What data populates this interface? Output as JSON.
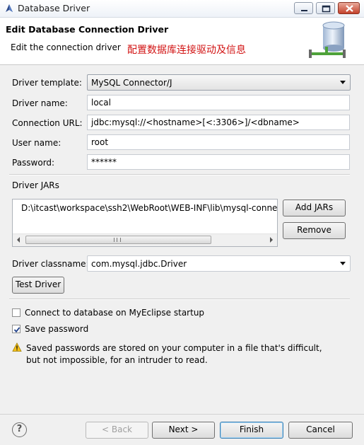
{
  "window": {
    "title": "Database Driver",
    "controls": {
      "minimize": "minimize-icon",
      "maximize": "maximize-icon",
      "close": "close-icon"
    }
  },
  "header": {
    "title": "Edit Database Connection Driver",
    "description": "Edit the connection driver",
    "note": "配置数据库连接驱动及信息"
  },
  "form": {
    "driver_template": {
      "label": "Driver template:",
      "value": "MySQL Connector/J"
    },
    "driver_name": {
      "label": "Driver name:",
      "value": "local"
    },
    "connection_url": {
      "label": "Connection URL:",
      "value": "jdbc:mysql://<hostname>[<:3306>]/<dbname>"
    },
    "user_name": {
      "label": "User name:",
      "value": "root"
    },
    "password": {
      "label": "Password:",
      "value": "******"
    }
  },
  "driver_jars": {
    "label": "Driver JARs",
    "items": [
      "D:\\itcast\\workspace\\ssh2\\WebRoot\\WEB-INF\\lib\\mysql-conne"
    ],
    "add_button": "Add JARs",
    "remove_button": "Remove"
  },
  "driver_classname": {
    "label": "Driver classname:",
    "value": "com.mysql.jdbc.Driver"
  },
  "test_driver_button": "Test Driver",
  "options": {
    "connect_on_startup": {
      "label": "Connect to database on MyEclipse startup",
      "checked": false
    },
    "save_password": {
      "label": "Save password",
      "checked": true
    }
  },
  "warning": {
    "icon": "warning-icon",
    "text": "Saved passwords are stored on your computer in a file that's difficult, but not impossible, for an intruder to read."
  },
  "footer": {
    "help": "?",
    "back": "< Back",
    "next": "Next >",
    "finish": "Finish",
    "cancel": "Cancel"
  },
  "colors": {
    "accent_note": "#d21414",
    "dialog_bg": "#f0f0f0",
    "default_button_border": "#3c7fb1"
  }
}
